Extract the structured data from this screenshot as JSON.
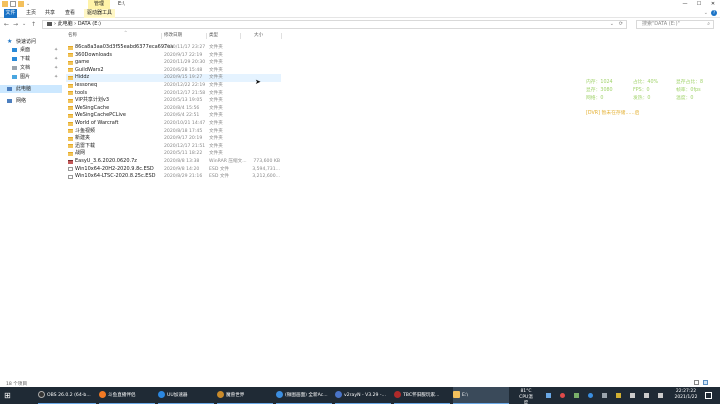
{
  "titlebar": {
    "manage_label": "管理",
    "title": "E:\\",
    "minimize": "—",
    "maximize": "☐",
    "close": "✕"
  },
  "ribbon": {
    "tabs": [
      {
        "label": "文件"
      },
      {
        "label": "主页"
      },
      {
        "label": "共享"
      },
      {
        "label": "查看"
      },
      {
        "label": "驱动器工具"
      }
    ]
  },
  "address": {
    "back": "←",
    "forward": "→",
    "recent": "⌄",
    "up": "↑",
    "path": "›  此电脑  ›  DATA (E:)",
    "dropdown": "⌄",
    "refresh": "⟳",
    "search_placeholder": "搜索\"DATA (E:)\""
  },
  "sidebar": {
    "items": [
      {
        "label": "快速访问",
        "pin": ""
      },
      {
        "label": "桌面",
        "pin": "📌"
      },
      {
        "label": "下载",
        "pin": "📌"
      },
      {
        "label": "文档",
        "pin": "📌"
      },
      {
        "label": "图片",
        "pin": "📌"
      },
      {
        "label": "此电脑",
        "pin": ""
      },
      {
        "label": "网络",
        "pin": ""
      }
    ]
  },
  "columns": {
    "name": "名称",
    "date": "修改日期",
    "type": "类型",
    "size": "大小"
  },
  "files": [
    {
      "name": "86ca8a3aa03d3f55eabd6377eca697ea",
      "date": "2020/11/17 23:27",
      "type": "文件夹",
      "size": "",
      "kind": "folder"
    },
    {
      "name": "360Downloads",
      "date": "2020/9/17 22:19",
      "type": "文件夹",
      "size": "",
      "kind": "folder"
    },
    {
      "name": "game",
      "date": "2020/11/29 20:30",
      "type": "文件夹",
      "size": "",
      "kind": "folder"
    },
    {
      "name": "GuildWars2",
      "date": "2020/6/28 15:48",
      "type": "文件夹",
      "size": "",
      "kind": "folder"
    },
    {
      "name": "Hiddz",
      "date": "2020/9/15 19:27",
      "type": "文件夹",
      "size": "",
      "kind": "folder"
    },
    {
      "name": "lessoneq",
      "date": "2020/12/22 22:19",
      "type": "文件夹",
      "size": "",
      "kind": "folder"
    },
    {
      "name": "tools",
      "date": "2020/12/17 21:58",
      "type": "文件夹",
      "size": "",
      "kind": "folder"
    },
    {
      "name": "VIP共享计划v3",
      "date": "2020/5/13 19:05",
      "type": "文件夹",
      "size": "",
      "kind": "folder"
    },
    {
      "name": "WeSingCache",
      "date": "2020/8/4 15:56",
      "type": "文件夹",
      "size": "",
      "kind": "folder"
    },
    {
      "name": "WeSingCachePCLive",
      "date": "2020/6/4 22:51",
      "type": "文件夹",
      "size": "",
      "kind": "folder"
    },
    {
      "name": "World of Warcraft",
      "date": "2020/10/21 14:47",
      "type": "文件夹",
      "size": "",
      "kind": "folder"
    },
    {
      "name": "斗鱼视频",
      "date": "2020/8/18 17:45",
      "type": "文件夹",
      "size": "",
      "kind": "folder"
    },
    {
      "name": "新建夹",
      "date": "2020/9/17 20:19",
      "type": "文件夹",
      "size": "",
      "kind": "folder"
    },
    {
      "name": "迅雷下载",
      "date": "2020/12/17 21:51",
      "type": "文件夹",
      "size": "",
      "kind": "folder"
    },
    {
      "name": "战网",
      "date": "2020/5/11 18:22",
      "type": "文件夹",
      "size": "",
      "kind": "folder"
    },
    {
      "name": "EasyU_3.6.2020.0620.7z",
      "date": "2020/8/8 13:38",
      "type": "WinRAR 压缩文...",
      "size": "773,600 KB",
      "kind": "zip"
    },
    {
      "name": "Win10x64-20H2-2020.9.8c.ESD",
      "date": "2020/9/8 14:20",
      "type": "ESD 文件",
      "size": "3,594,731...",
      "kind": "doc"
    },
    {
      "name": "Win10x64-LTSC-2020.8.25c.ESD",
      "date": "2020/8/29 21:16",
      "type": "ESD 文件",
      "size": "3,212,600...",
      "kind": "doc"
    }
  ],
  "stats": {
    "items": [
      {
        "text": "内存：1024"
      },
      {
        "text": "占比：40%"
      },
      {
        "text": "显存占比：8"
      },
      {
        "text": "显存：3080"
      },
      {
        "text": "FPS：0"
      },
      {
        "text": "帧率：0fps"
      },
      {
        "text": "网络：0"
      },
      {
        "text": "发热：0"
      },
      {
        "text": "温度：0"
      }
    ],
    "warning": "[DVR] 暂未在存储......启"
  },
  "statusbar": {
    "count": "18 个项目"
  },
  "taskbar": {
    "start": "⊞",
    "items": [
      {
        "label": "OBS 26.0.2 (64-b..."
      },
      {
        "label": "斗鱼直播伴侣"
      },
      {
        "label": "UU加速器"
      },
      {
        "label": "魔兽世界"
      },
      {
        "label": "(微图画面) 全新Ac..."
      },
      {
        "label": "v2rayN - V3.29 -..."
      },
      {
        "label": "TBC怀旧服玩家..."
      },
      {
        "label": "E:\\"
      }
    ],
    "weather": "81°C",
    "weather_sub": "CPU温度",
    "time": "22:27:22",
    "date": "2021/1/22"
  }
}
